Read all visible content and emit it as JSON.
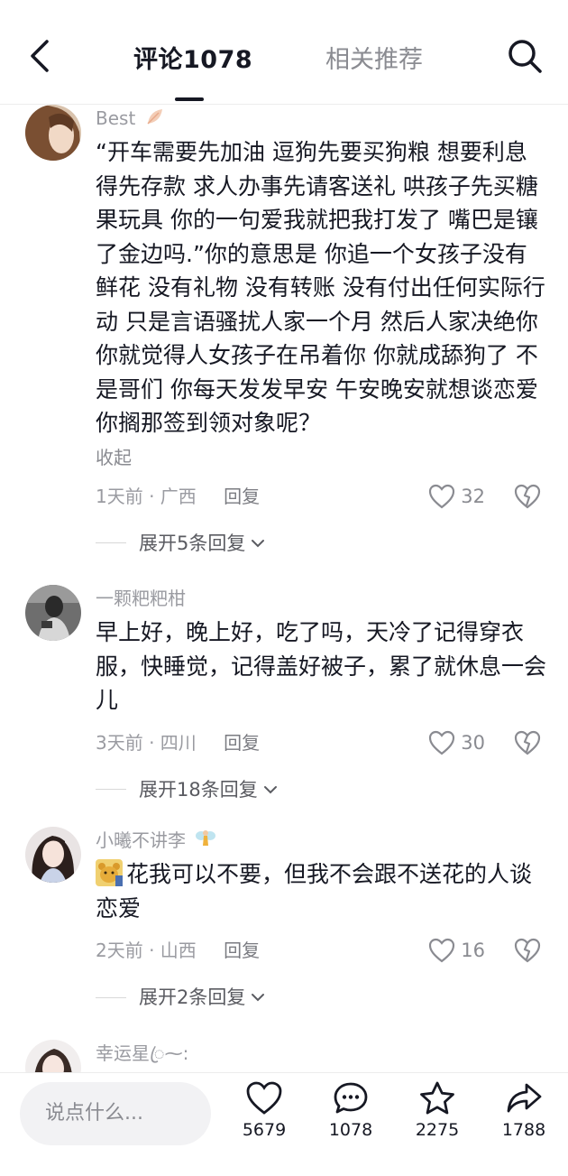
{
  "header": {
    "comments_tab": "评论1078",
    "related_tab": "相关推荐"
  },
  "comments": [
    {
      "username": "Best",
      "text": "“开车需要先加油 逗狗先要买狗粮 想要利息得先存款 求人办事先请客送礼 哄孩子先买糖果玩具 你的一句爱我就把我打发了 嘴巴是镶了金边吗.”你的意思是 你追一个女孩子没有鲜花 没有礼物 没有转账 没有付出任何实际行动 只是言语骚扰人家一个月 然后人家决绝你 你就觉得人女孩子在吊着你 你就成舔狗了 不是哥们 你每天发发早安 午安晚安就想谈恋爱 你搁那签到领对象呢？",
      "collapse": "收起",
      "time_location": "1天前 · 广西",
      "reply": "回复",
      "likes": "32",
      "expand": "展开5条回复"
    },
    {
      "username": "一颗粑粑柑",
      "text": "早上好，晚上好，吃了吗，天冷了记得穿衣服，快睡觉，记得盖好被子，累了就休息一会儿",
      "time_location": "3天前 · 四川",
      "reply": "回复",
      "likes": "30",
      "expand": "展开18条回复"
    },
    {
      "username": "小曦不讲李",
      "text": "花我可以不要，但我不会跟不送花的人谈恋爱",
      "time_location": "2天前 · 山西",
      "reply": "回复",
      "likes": "16",
      "expand": "展开2条回复"
    },
    {
      "username": "幸运星ꦿ⁓:"
    }
  ],
  "bottom_bar": {
    "input_placeholder": "说点什么...",
    "like_count": "5679",
    "comment_count": "1078",
    "favorite_count": "2275",
    "share_count": "1788"
  },
  "icons": {
    "back": "chevron-left-icon",
    "search": "search-icon",
    "like": "heart-icon",
    "dislike": "broken-heart-icon",
    "comment": "comment-bubble-icon",
    "favorite": "star-icon",
    "share": "share-arrow-icon"
  }
}
